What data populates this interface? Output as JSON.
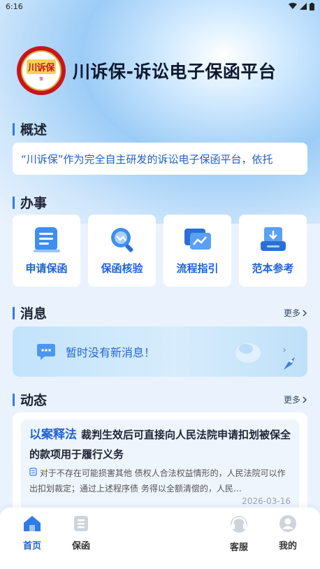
{
  "status_bar": {
    "time": "6:16"
  },
  "brand": {
    "logo_text": "川诉保",
    "logo_sub": "保",
    "title": "川诉保-诉讼电子保函平台"
  },
  "overview": {
    "title": "概述",
    "text": "“川诉保”作为完全自主研发的诉讼电子保函平台，依托"
  },
  "services": {
    "title": "办事",
    "items": [
      {
        "label": "申请保函",
        "icon": "document-list-icon"
      },
      {
        "label": "保函核验",
        "icon": "search-verify-icon"
      },
      {
        "label": "流程指引",
        "icon": "flow-chart-icon"
      },
      {
        "label": "范本参考",
        "icon": "download-tray-icon"
      }
    ]
  },
  "messages": {
    "title": "消息",
    "more": "更多",
    "empty_text": "暂时没有新消息！"
  },
  "news": {
    "title": "动态",
    "more": "更多",
    "tag": "以案释法",
    "headline": "裁判生效后可直接向人民法院申请扣划被保全的款项用于履行义务",
    "body": "对于不存在可能损害其他 债权人合法权益情形的，人民法院可以作出扣划裁定；通过上述程序债 务得以全额清偿的，人民…",
    "date": "2026-03-16"
  },
  "tabbar": {
    "items": [
      {
        "label": "首页",
        "active": true
      },
      {
        "label": "保函",
        "active": false
      },
      {
        "label": "客服",
        "active": false
      },
      {
        "label": "我的",
        "active": false
      }
    ]
  },
  "colors": {
    "accent": "#1f63d3",
    "section_bar": "#2f7be8",
    "brand_red": "#c8151b"
  }
}
